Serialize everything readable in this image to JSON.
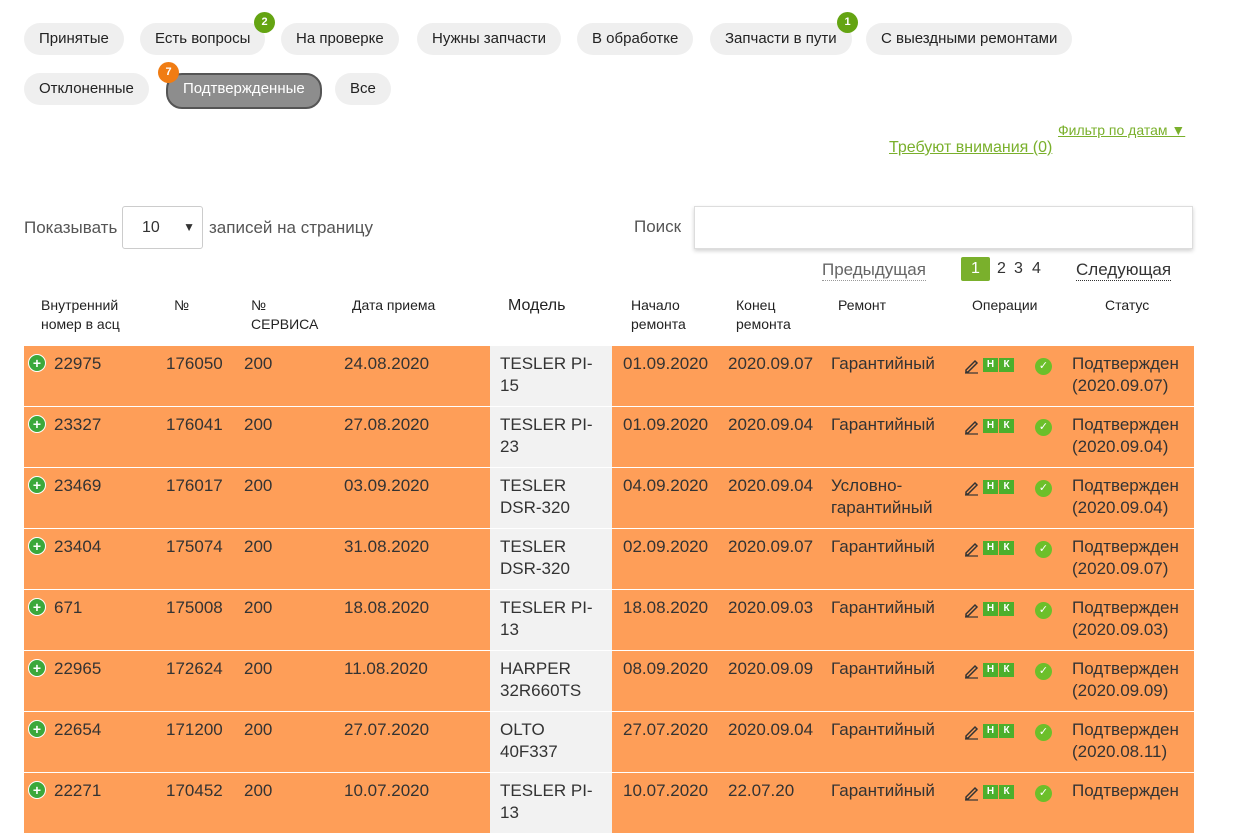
{
  "filters": [
    {
      "label": "Принятые",
      "badge": null,
      "active": false
    },
    {
      "label": "Есть вопросы",
      "badge": "2",
      "active": false
    },
    {
      "label": "На проверке",
      "badge": null,
      "active": false
    },
    {
      "label": "Нужны запчасти",
      "badge": null,
      "active": false
    },
    {
      "label": "В обработке",
      "badge": null,
      "active": false
    },
    {
      "label": "Запчасти в пути",
      "badge": "1",
      "active": false
    },
    {
      "label": "С выездными ремонтами",
      "badge": null,
      "active": false
    },
    {
      "label": "Отклоненные",
      "badge": null,
      "active": false
    },
    {
      "label": "Подтвержденные",
      "badge": "7",
      "active": true
    },
    {
      "label": "Все",
      "badge": null,
      "active": false
    }
  ],
  "links": {
    "date_filter": "Фильтр по датам ▼",
    "attention": "Требуют внимания (0)"
  },
  "controls": {
    "show_label": "Показывать",
    "per_page_value": "10",
    "per_page_suffix": "записей на страницу",
    "search_label": "Поиск",
    "search_value": ""
  },
  "pagination": {
    "prev": "Предыдущая",
    "next": "Следующая",
    "pages": [
      "1",
      "2",
      "3",
      "4"
    ],
    "current": "1"
  },
  "columns": [
    "Внутренний номер в асц",
    "№",
    "№ СЕРВИСА",
    "Дата приема",
    "Модель",
    "Начало ремонта",
    "Конец ремонта",
    "Ремонт",
    "Операции",
    "Статус"
  ],
  "operations": {
    "n": "Н",
    "k": "К"
  },
  "rows": [
    {
      "internal": "22975",
      "num": "176050",
      "service": "200",
      "received": "24.08.2020",
      "model": "TESLER PI-15",
      "start": "01.09.2020",
      "end": "2020.09.07",
      "repair": "Гарантийный",
      "status": "Подтвержден (2020.09.07)"
    },
    {
      "internal": "23327",
      "num": "176041",
      "service": "200",
      "received": "27.08.2020",
      "model": "TESLER PI-23",
      "start": "01.09.2020",
      "end": "2020.09.04",
      "repair": "Гарантийный",
      "status": "Подтвержден (2020.09.04)"
    },
    {
      "internal": "23469",
      "num": "176017",
      "service": "200",
      "received": "03.09.2020",
      "model": "TESLER DSR-320",
      "start": "04.09.2020",
      "end": "2020.09.04",
      "repair": "Условно-гарантийный",
      "status": "Подтвержден (2020.09.04)"
    },
    {
      "internal": "23404",
      "num": "175074",
      "service": "200",
      "received": "31.08.2020",
      "model": "TESLER DSR-320",
      "start": "02.09.2020",
      "end": "2020.09.07",
      "repair": "Гарантийный",
      "status": "Подтвержден (2020.09.07)"
    },
    {
      "internal": "671",
      "num": "175008",
      "service": "200",
      "received": "18.08.2020",
      "model": "TESLER PI-13",
      "start": "18.08.2020",
      "end": "2020.09.03",
      "repair": "Гарантийный",
      "status": "Подтвержден (2020.09.03)"
    },
    {
      "internal": "22965",
      "num": "172624",
      "service": "200",
      "received": "11.08.2020",
      "model": "HARPER 32R660TS",
      "start": "08.09.2020",
      "end": "2020.09.09",
      "repair": "Гарантийный",
      "status": "Подтвержден (2020.09.09)"
    },
    {
      "internal": "22654",
      "num": "171200",
      "service": "200",
      "received": "27.07.2020",
      "model": "OLTO 40F337",
      "start": "27.07.2020",
      "end": "2020.09.04",
      "repair": "Гарантийный",
      "status": "Подтвержден (2020.08.11)"
    },
    {
      "internal": "22271",
      "num": "170452",
      "service": "200",
      "received": "10.07.2020",
      "model": "TESLER PI-13",
      "start": "10.07.2020",
      "end": "22.07.20",
      "repair": "Гарантийный",
      "status": "Подтвержден"
    }
  ],
  "colors": {
    "row_bg": "#fe9e58",
    "model_bg": "#f2f2f2",
    "accent_green": "#7ab02c",
    "badge_green": "#64a412",
    "badge_orange": "#f07c13"
  }
}
